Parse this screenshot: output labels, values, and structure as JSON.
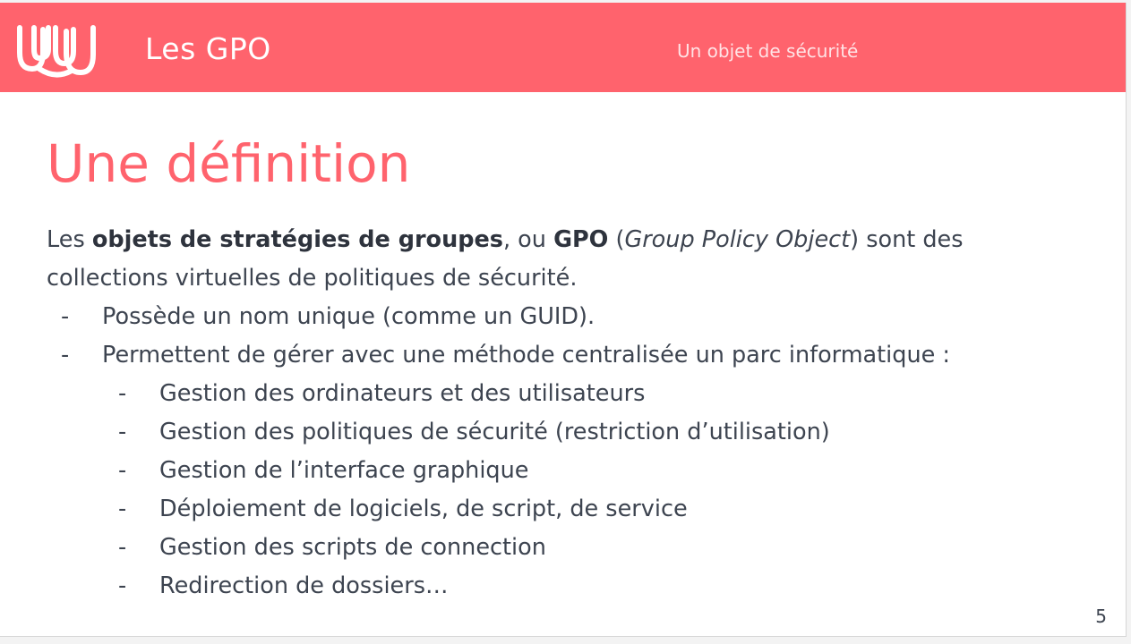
{
  "header": {
    "section_title": "Les GPO",
    "subtitle": "Un objet de sécurité",
    "logo_icon": "wave-logo-icon",
    "accent_color": "#ff636d"
  },
  "slide": {
    "title": "Une définition",
    "intro": {
      "t1": "Les ",
      "b1": "objets de stratégies de groupes",
      "t2": ", ou ",
      "b2": "GPO",
      "t3": " (",
      "i1": "Group Policy Object",
      "t4": ") sont des",
      "line2": "collections virtuelles de politiques de sécurité."
    },
    "bullets": [
      {
        "dash": "-",
        "text": "Possède un nom unique (comme un GUID)."
      },
      {
        "dash": "-",
        "text": "Permettent de gérer avec une méthode centralisée un parc informatique :"
      }
    ],
    "sub_bullets": [
      {
        "dash": "-",
        "text": "Gestion des ordinateurs et des utilisateurs"
      },
      {
        "dash": "-",
        "text": "Gestion des politiques de sécurité (restriction d’utilisation)"
      },
      {
        "dash": "-",
        "text": "Gestion de l’interface graphique"
      },
      {
        "dash": "-",
        "text": "Déploiement de logiciels, de script, de service"
      },
      {
        "dash": "-",
        "text": "Gestion des scripts de connection"
      },
      {
        "dash": "-",
        "text": "Redirection de dossiers…"
      }
    ],
    "page_number": "5"
  }
}
